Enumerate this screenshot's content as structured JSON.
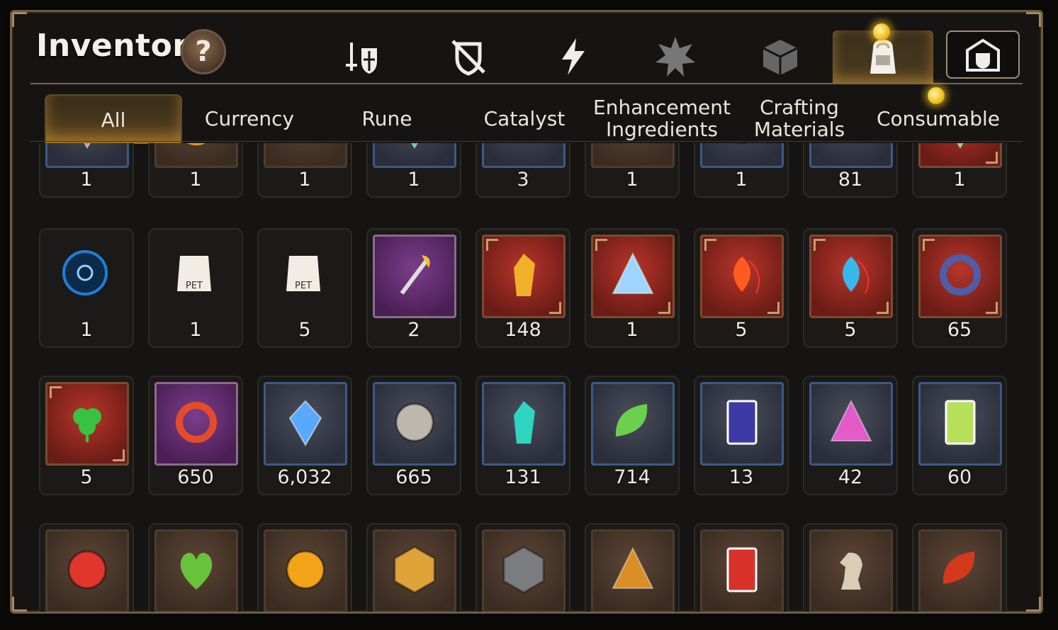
{
  "header": {
    "title": "Inventory",
    "help_label": "?"
  },
  "top_icons": [
    {
      "name": "equipment-icon"
    },
    {
      "name": "no-equipment-icon"
    },
    {
      "name": "lightning-icon"
    },
    {
      "name": "artifact-icon"
    },
    {
      "name": "cube-icon"
    },
    {
      "name": "bag-icon"
    },
    {
      "name": "storage-icon"
    }
  ],
  "tabs": [
    {
      "label": "All"
    },
    {
      "label": "Currency"
    },
    {
      "label": "Rune"
    },
    {
      "label": "Catalyst"
    },
    {
      "label": "Enhancement\nIngredients"
    },
    {
      "label": "Crafting\nMaterials"
    },
    {
      "label": "Consumable"
    }
  ],
  "rows": [
    [
      {
        "count": "1",
        "icon": "pink-crystal-icon"
      },
      {
        "count": "1",
        "icon": "gold-ring-icon"
      },
      {
        "count": "1",
        "icon": "dark-ore-icon"
      },
      {
        "count": "1",
        "icon": "green-gem-icon"
      },
      {
        "count": "3",
        "icon": "wood-plank-icon"
      },
      {
        "count": "1",
        "icon": "black-stones-icon"
      },
      {
        "count": "1",
        "icon": "blue-orb-icon"
      },
      {
        "count": "81",
        "icon": "green-leaves-icon"
      },
      {
        "count": "1",
        "icon": "green-emblem-icon"
      }
    ],
    [
      {
        "count": "1",
        "icon": "blue-rune-circle-icon"
      },
      {
        "count": "1",
        "icon": "pet-food-bag-icon"
      },
      {
        "count": "5",
        "icon": "pet-food-bag-icon"
      },
      {
        "count": "2",
        "icon": "feather-wand-icon"
      },
      {
        "count": "148",
        "icon": "gold-crystal-icon"
      },
      {
        "count": "1",
        "icon": "blue-triangle-gem-icon"
      },
      {
        "count": "5",
        "icon": "fire-pendant-icon"
      },
      {
        "count": "5",
        "icon": "water-pendant-icon"
      },
      {
        "count": "65",
        "icon": "moon-pendant-icon"
      }
    ],
    [
      {
        "count": "5",
        "icon": "clover-pendant-icon"
      },
      {
        "count": "650",
        "icon": "flower-charm-icon"
      },
      {
        "count": "6,032",
        "icon": "blue-crystal-icon"
      },
      {
        "count": "665",
        "icon": "silver-coin-icon"
      },
      {
        "count": "131",
        "icon": "cyan-crystal-icon"
      },
      {
        "count": "714",
        "icon": "green-leaf-icon"
      },
      {
        "count": "13",
        "icon": "blue-card-icon"
      },
      {
        "count": "42",
        "icon": "pink-crystal-pile-icon"
      },
      {
        "count": "60",
        "icon": "green-card-icon"
      }
    ],
    [
      {
        "count": "",
        "icon": "red-badge-icon"
      },
      {
        "count": "",
        "icon": "green-heart-icon"
      },
      {
        "count": "",
        "icon": "sun-coin-icon"
      },
      {
        "count": "",
        "icon": "gold-hexagon-icon"
      },
      {
        "count": "",
        "icon": "stone-compass-icon"
      },
      {
        "count": "",
        "icon": "fist-emblem-icon"
      },
      {
        "count": "",
        "icon": "red-banner-icon"
      },
      {
        "count": "",
        "icon": "chess-knight-icon"
      },
      {
        "count": "",
        "icon": "red-leaves-icon"
      }
    ]
  ]
}
